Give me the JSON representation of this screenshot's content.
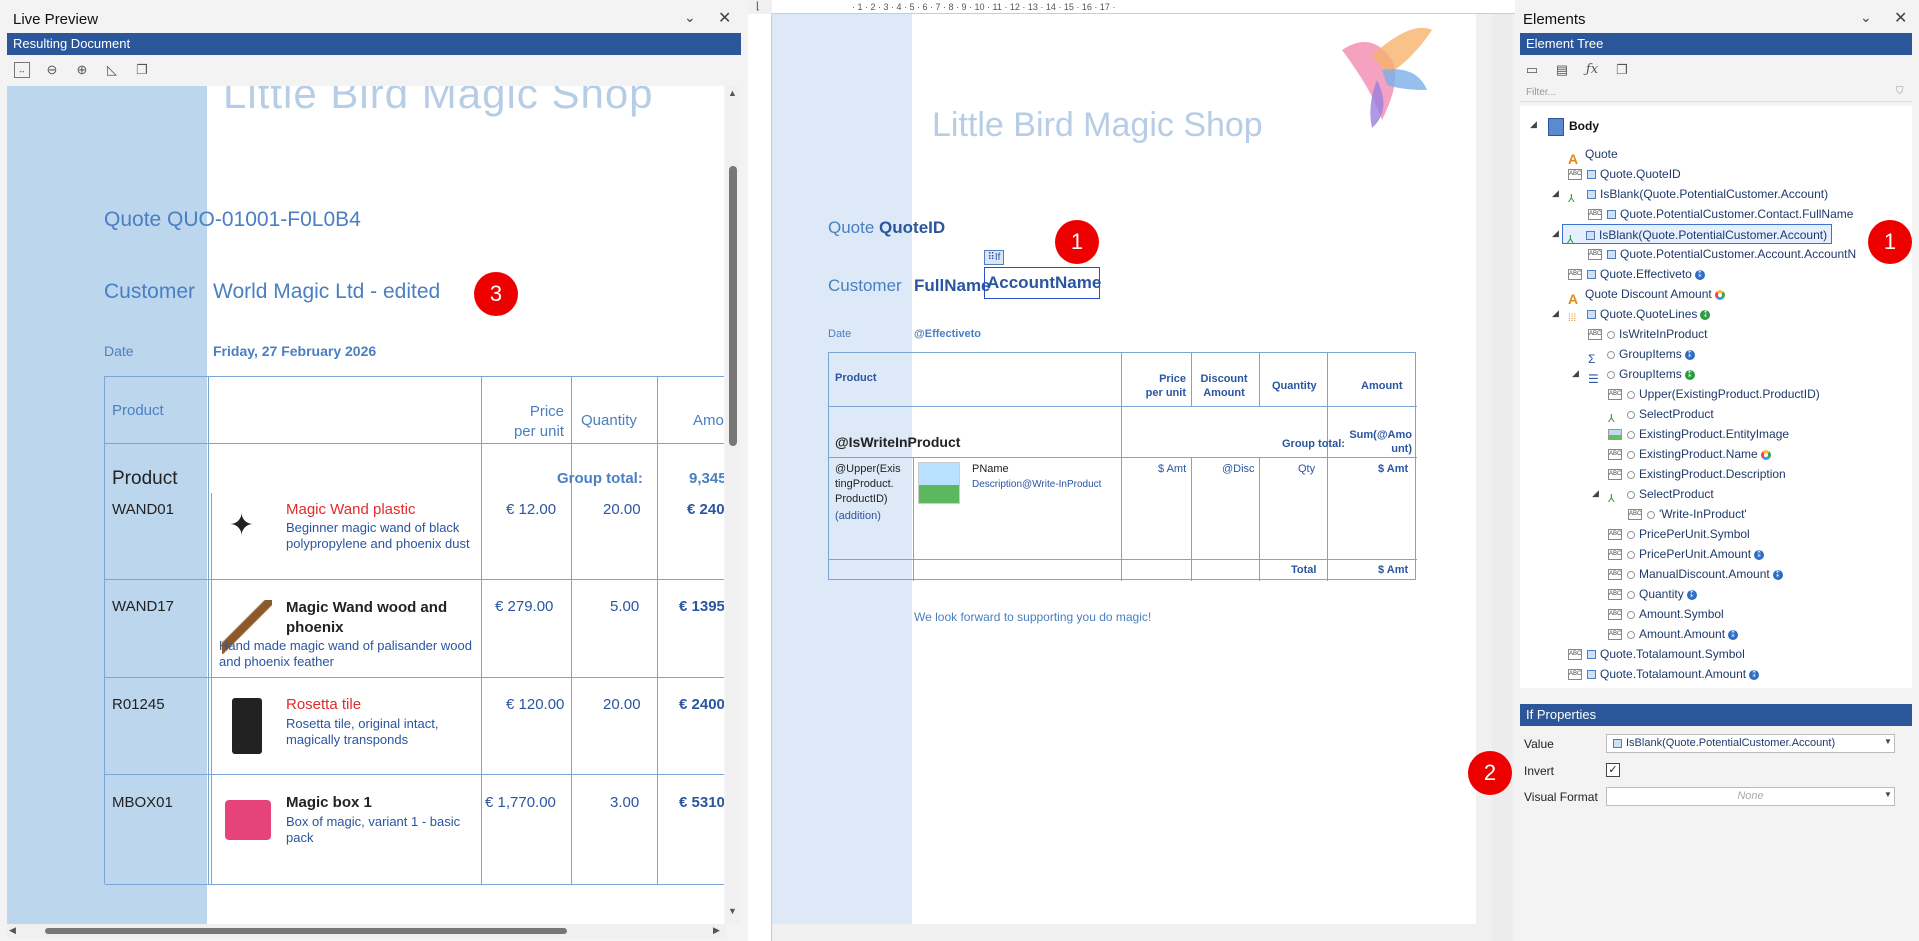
{
  "live_preview": {
    "title": "Live Preview",
    "bar": "Resulting Document",
    "shop_title": "Little Bird Magic Shop",
    "quote_line": "Quote QUO-01001-F0L0B4",
    "customer_label": "Customer",
    "customer_value": "World Magic Ltd - edited",
    "date_label": "Date",
    "date_value": "Friday, 27 February 2026",
    "headers": {
      "product": "Product",
      "price": "Price\nper unit",
      "quantity": "Quantity",
      "amount": "Amo"
    },
    "group_label": "Product",
    "group_total_label": "Group total:",
    "group_total_value": "9,345",
    "rows": [
      {
        "code": "WAND01",
        "name": "Magic Wand plastic",
        "desc": "Beginner magic wand of black polypropylene and phoenix dust",
        "price": "€ 12.00",
        "qty": "20.00",
        "amount": "€ 240"
      },
      {
        "code": "WAND17",
        "name": "Magic Wand wood and phoenix",
        "desc": "Hand made magic wand of palisander wood and phoenix feather",
        "price": "€ 279.00",
        "qty": "5.00",
        "amount": "€ 1395"
      },
      {
        "code": "R01245",
        "name": "Rosetta tile",
        "desc": "Rosetta tile, original intact, magically transponds",
        "price": "€ 120.00",
        "qty": "20.00",
        "amount": "€ 2400"
      },
      {
        "code": "MBOX01",
        "name": "Magic box 1",
        "desc": "Box of magic, variant 1 - basic pack",
        "price": "€ 1,770.00",
        "qty": "3.00",
        "amount": "€ 5310"
      }
    ],
    "badge": "3"
  },
  "designer": {
    "shop_title": "Little Bird Magic Shop",
    "quote_label": "Quote",
    "quote_field": "QuoteID",
    "customer_label": "Customer",
    "fullname": "FullName",
    "accountname": "AccountName",
    "if_tag": "If",
    "date_label": "Date",
    "date_field": "@Effectiveto",
    "headers": {
      "product": "Product",
      "price": "Price\nper unit",
      "discount": "Discount\nAmount",
      "quantity": "Quantity",
      "amount": "Amount"
    },
    "group_field": "@IsWriteInProduct",
    "group_total_label": "Group total:",
    "group_total_field": "Sum(@Amo\nunt)",
    "row_code": "@Upper(Exis\ntingProduct.\nProductID)",
    "row_addition": "(addition)",
    "pname": "PName",
    "pdesc": "Description@Write-InProduct",
    "price_cell": "$ Amt",
    "disc_cell": "@Disc",
    "qty_cell": "Qty",
    "amt_cell": "$ Amt",
    "total_label": "Total",
    "total_value": "$ Amt",
    "footer": "We look forward to supporting you do magic!",
    "badge": "1",
    "ruler": "· 1 · 2 · 3 · 4 · 5 · 6 · 7 · 8 · 9 · 10 · 11 · 12 · 13 · 14 · 15 · 16 · 17 ·"
  },
  "elements": {
    "title": "Elements",
    "bar": "Element Tree",
    "filter_placeholder": "Filter...",
    "tree": [
      {
        "label": "Body"
      },
      {
        "label": "Quote"
      },
      {
        "label": "Quote.QuoteID"
      },
      {
        "label": "IsBlank(Quote.PotentialCustomer.Account)"
      },
      {
        "label": "Quote.PotentialCustomer.Contact.FullName"
      },
      {
        "label": "IsBlank(Quote.PotentialCustomer.Account)"
      },
      {
        "label": "Quote.PotentialCustomer.Account.AccountN"
      },
      {
        "label": "Quote.Effectiveto"
      },
      {
        "label": "Quote Discount Amount"
      },
      {
        "label": "Quote.QuoteLines"
      },
      {
        "label": "IsWriteInProduct"
      },
      {
        "label": "GroupItems"
      },
      {
        "label": "GroupItems"
      },
      {
        "label": "Upper(ExistingProduct.ProductID)"
      },
      {
        "label": "SelectProduct"
      },
      {
        "label": "ExistingProduct.EntityImage"
      },
      {
        "label": "ExistingProduct.Name"
      },
      {
        "label": "ExistingProduct.Description"
      },
      {
        "label": "SelectProduct"
      },
      {
        "label": "'Write-InProduct'"
      },
      {
        "label": "PricePerUnit.Symbol"
      },
      {
        "label": "PricePerUnit.Amount"
      },
      {
        "label": "ManualDiscount.Amount"
      },
      {
        "label": "Quantity"
      },
      {
        "label": "Amount.Symbol"
      },
      {
        "label": "Amount.Amount"
      },
      {
        "label": "Quote.Totalamount.Symbol"
      },
      {
        "label": "Quote.Totalamount.Amount"
      }
    ],
    "badge": "1",
    "if_props": {
      "title": "If Properties",
      "value_label": "Value",
      "value": "IsBlank(Quote.PotentialCustomer.Account)",
      "invert_label": "Invert",
      "visual_format_label": "Visual Format",
      "visual_format_value": "None",
      "badge": "2"
    }
  },
  "colors": {
    "accent": "#2b579a",
    "doc_blue": "#4a7fc1",
    "left_band": "#bcd6ee",
    "badge": "#e00000",
    "red_text": "#e32b2b"
  }
}
